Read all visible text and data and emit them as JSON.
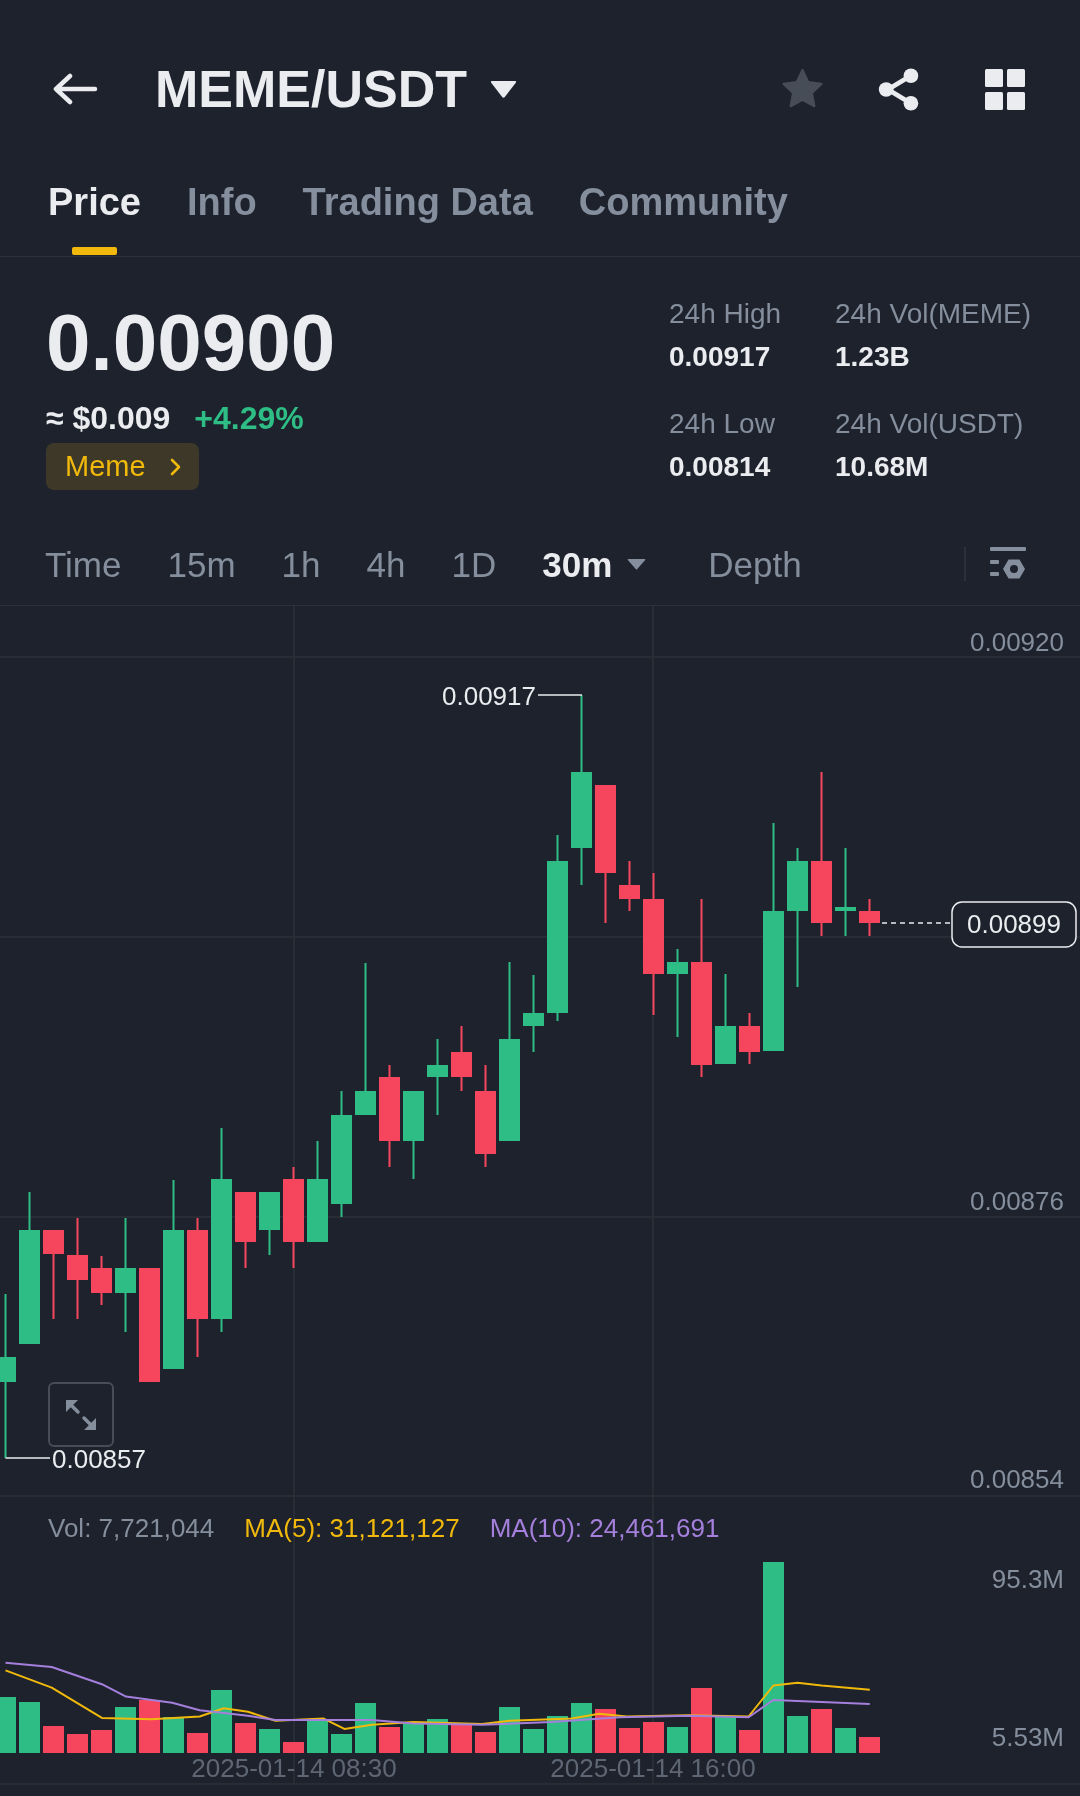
{
  "header": {
    "pair": "MEME/USDT",
    "starred": false
  },
  "tabs": [
    {
      "label": "Price",
      "selected": true
    },
    {
      "label": "Info",
      "selected": false
    },
    {
      "label": "Trading Data",
      "selected": false
    },
    {
      "label": "Community",
      "selected": false
    }
  ],
  "ticker": {
    "price": "0.00900",
    "fiat_price": "≈ $0.009",
    "change": "+4.29%",
    "change_positive": true,
    "tag": "Meme",
    "stats": [
      {
        "label": "24h High",
        "value": "0.00917"
      },
      {
        "label": "24h Vol(MEME)",
        "value": "1.23B"
      },
      {
        "label": "24h Low",
        "value": "0.00814"
      },
      {
        "label": "24h Vol(USDT)",
        "value": "10.68M"
      }
    ]
  },
  "intervals": [
    {
      "label": "Time",
      "kind": "interval",
      "selected": false
    },
    {
      "label": "15m",
      "kind": "interval",
      "selected": false
    },
    {
      "label": "1h",
      "kind": "interval",
      "selected": false
    },
    {
      "label": "4h",
      "kind": "interval",
      "selected": false
    },
    {
      "label": "1D",
      "kind": "interval",
      "selected": false
    },
    {
      "label": "30m",
      "kind": "dropdown",
      "selected": true
    },
    {
      "label": "Depth",
      "kind": "view",
      "selected": false
    }
  ],
  "price_chart": {
    "axis_labels": [
      "0.00920",
      "0.00876",
      "0.00854"
    ],
    "high_label": "0.00917",
    "low_label": "0.00857",
    "last_price": "0.00899"
  },
  "volume_chart": {
    "legend": [
      {
        "label": "Vol: 7,721,044",
        "color": "#848e9c"
      },
      {
        "label": "MA(5): 31,121,127",
        "color": "#f0b90b"
      },
      {
        "label": "MA(10): 24,461,691",
        "color": "#a47fdb"
      }
    ],
    "axis_labels": [
      "95.3M",
      "5.53M"
    ],
    "time_labels": [
      "2025-01-14 08:30",
      "2025-01-14 16:00"
    ]
  }
}
